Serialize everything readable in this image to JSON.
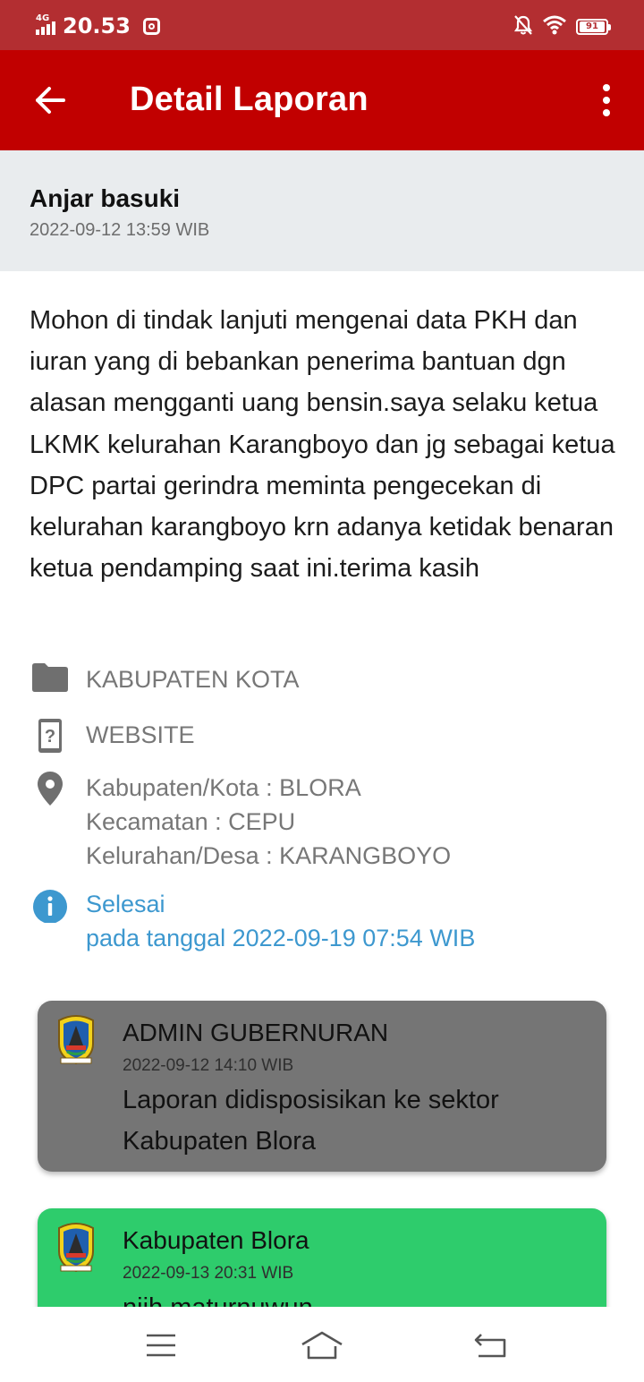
{
  "status_bar": {
    "network": "4G",
    "time": "20.53",
    "battery": "91",
    "icons": [
      "signal-icon",
      "instagram-icon",
      "notifications-off-icon",
      "wifi-icon",
      "battery-icon"
    ]
  },
  "app_bar": {
    "title": "Detail Laporan",
    "back_icon": "arrow-back-icon",
    "menu_icon": "more-vert-icon"
  },
  "report": {
    "reporter_name": "Anjar basuki",
    "reporter_date": "2022-09-12 13:59 WIB",
    "text": "Mohon di tindak lanjuti mengenai data PKH dan iuran yang di bebankan penerima bantuan dgn alasan mengganti uang bensin.saya selaku ketua LKMK kelurahan Karangboyo dan jg sebagai ketua DPC partai gerindra meminta pengecekan di kelurahan karangboyo krn adanya ketidak benaran ketua pendamping saat ini.terima kasih",
    "category": "KABUPATEN KOTA",
    "source": "WEBSITE",
    "location": {
      "kabupaten": "Kabupaten/Kota : BLORA",
      "kecamatan": "Kecamatan : CEPU",
      "kelurahan": "Kelurahan/Desa : KARANGBOYO"
    },
    "status": "Selesai",
    "status_date": "pada tanggal 2022-09-19 07:54 WIB",
    "status_color": "#3d98cf"
  },
  "comments": [
    {
      "author": "ADMIN GUBERNURAN",
      "date": "2022-09-12 14:10 WIB",
      "message": "Laporan didisposisikan ke sektor Kabupaten Blora",
      "color": "#757575"
    },
    {
      "author": "Kabupaten Blora",
      "date": "2022-09-13 20:31 WIB",
      "message": "njih maturnuwun",
      "color": "#2ecc6c"
    }
  ],
  "nav_bar": {
    "icons": [
      "menu-icon",
      "home-icon",
      "back-icon"
    ]
  },
  "colors": {
    "status_bar": "#b32e31",
    "app_bar": "#c10000",
    "header_bg": "#e9ecee"
  }
}
